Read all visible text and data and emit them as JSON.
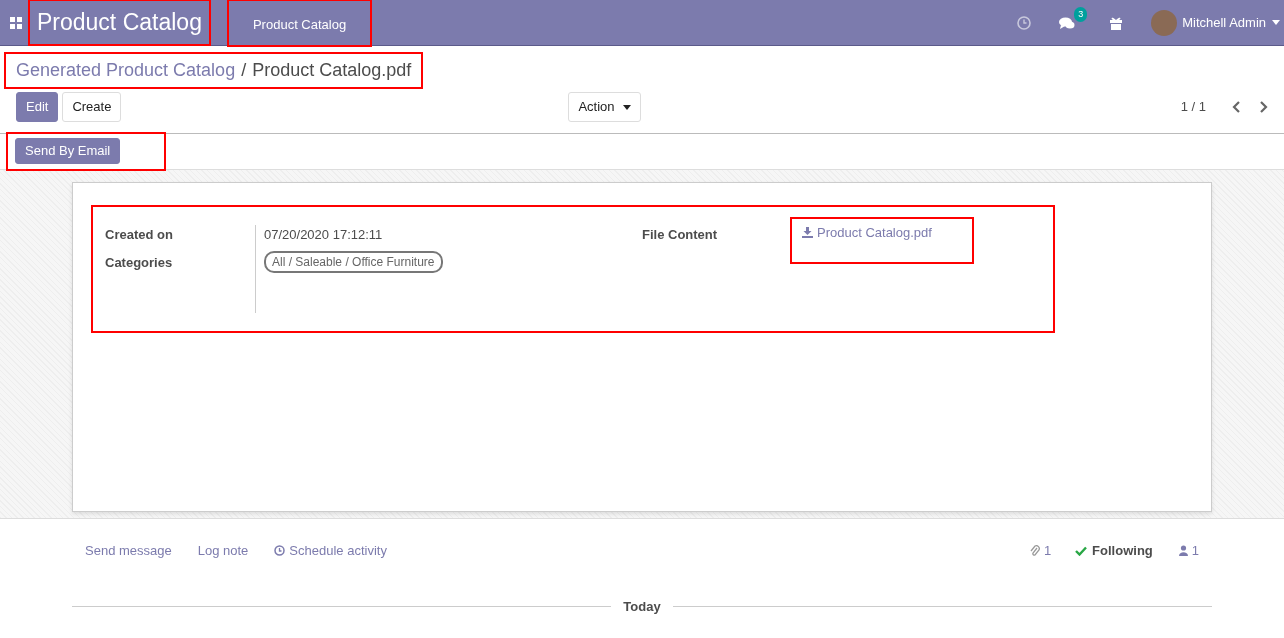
{
  "navbar": {
    "app_title": "Product Catalog",
    "app_title_highlighted": true,
    "menu": [
      {
        "label": "Product Catalog",
        "highlighted": true
      }
    ],
    "messages_badge": "3",
    "user": "Mitchell Admin"
  },
  "breadcrumb": {
    "highlighted": true,
    "separator": "/",
    "items": [
      {
        "label": "Generated Product Catalog",
        "kind": "link"
      },
      {
        "label": "Product Catalog.pdf",
        "kind": "current"
      }
    ]
  },
  "buttons": [
    {
      "label": "Edit",
      "kind": "primary"
    },
    {
      "label": "Create",
      "kind": "secondary"
    }
  ],
  "action_menu": "Action",
  "pager": "1 / 1",
  "header_buttons": [
    {
      "label": "Send By Email",
      "highlighted": true
    }
  ],
  "form": {
    "highlighted": true,
    "left": [
      {
        "label": "Created on",
        "value": "07/20/2020 17:12:11",
        "kind": "text"
      },
      {
        "label": "Categories",
        "value": "All / Saleable / Office Furniture",
        "kind": "tag"
      }
    ],
    "right": [
      {
        "label": "File Content",
        "value": "Product Catalog.pdf",
        "kind": "file",
        "highlighted": true
      }
    ]
  },
  "chatter": {
    "actions": [
      {
        "label": "Send message",
        "kind": "plain"
      },
      {
        "label": "Log note",
        "kind": "plain"
      },
      {
        "label": "Schedule activity",
        "kind": "clock"
      }
    ],
    "attachments": "1",
    "following": "Following",
    "followers": "1",
    "divider": "Today"
  }
}
